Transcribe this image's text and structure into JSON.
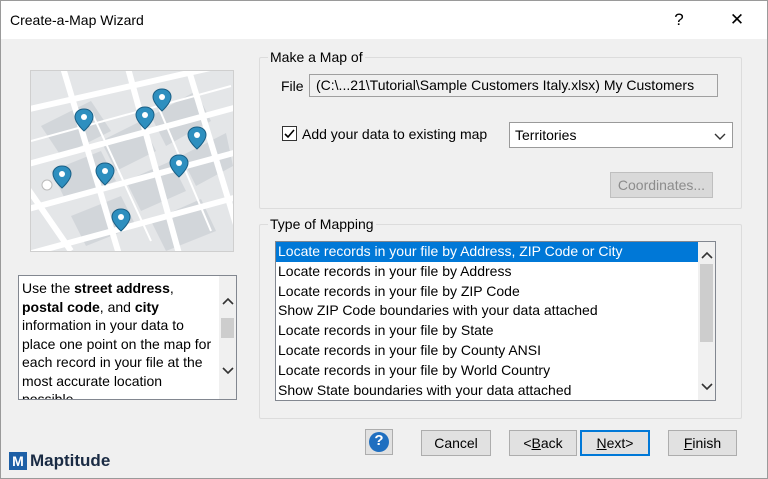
{
  "window": {
    "title": "Create-a-Map Wizard",
    "help_glyph": "?",
    "close_glyph": "✕"
  },
  "make_map": {
    "legend": "Make a Map of",
    "file_label": "File",
    "file_value": "(C:\\...21\\Tutorial\\Sample Customers Italy.xlsx) My Customers",
    "add_to_existing_label": "Add your data to existing map",
    "add_to_existing_checked": true,
    "existing_map_value": "Territories",
    "coordinates_label": "Coordinates..."
  },
  "type_of_mapping": {
    "legend": "Type of Mapping",
    "options": [
      "Locate records in your file by Address, ZIP Code or City",
      "Locate records in your file by Address",
      "Locate records in your file by ZIP Code",
      "Show ZIP Code boundaries with your data attached",
      "Locate records in your file by State",
      "Locate records in your file by County ANSI",
      "Locate records in your file by World Country",
      "Show State boundaries with your data attached"
    ],
    "selected_index": 0
  },
  "description": {
    "p1": "Use the ",
    "b1": "street address",
    "p2": ", ",
    "b2": "postal code",
    "p3": ", and ",
    "b3": "city",
    "p4": " information in your data to place one point on the map for each record in your file at the most accurate location possible."
  },
  "footer": {
    "logo_text": "Maptitude",
    "logo_mark": "M",
    "help_icon_glyph": "?",
    "cancel_label": "Cancel",
    "back_label_pre": "<",
    "back_label_key": "B",
    "back_label_post": "ack",
    "next_label_key": "N",
    "next_label_post": "ext>",
    "finish_label_key": "F",
    "finish_label_post": "inish"
  },
  "colors": {
    "accent": "#0078d7",
    "pin": "#2e8fbf",
    "logo": "#1d5fa6"
  }
}
